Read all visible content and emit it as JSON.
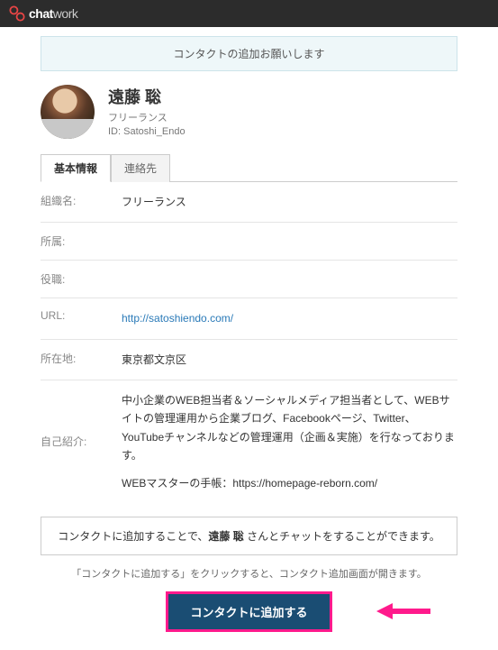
{
  "brand": {
    "part1": "chat",
    "part2": "work"
  },
  "notice": "コンタクトの追加お願いします",
  "profile": {
    "name": "遠藤 聡",
    "role": "フリーランス",
    "id_label": "ID: Satoshi_Endo"
  },
  "tabs": {
    "basic": "基本情報",
    "contact": "連絡先"
  },
  "labels": {
    "org": "組織名:",
    "dept": "所属:",
    "title": "役職:",
    "url": "URL:",
    "location": "所在地:",
    "intro": "自己紹介:"
  },
  "values": {
    "org": "フリーランス",
    "dept": "",
    "title": "",
    "url": "http://satoshiendo.com/",
    "location": "東京都文京区",
    "intro1": "中小企業のWEB担当者＆ソーシャルメディア担当者として、WEBサイトの管理運用から企業ブログ、Facebookページ、Twitter、YouTubeチャンネルなどの管理運用（企画＆実施）を行なっております。",
    "intro2": "WEBマスターの手帳：https://homepage-reborn.com/"
  },
  "add_box_pre": "コンタクトに追加することで、",
  "add_box_name": "遠藤 聡",
  "add_box_post": " さんとチャットをすることができます。",
  "help_text": "「コンタクトに追加する」をクリックすると、コンタクト追加画面が開きます。",
  "cta": "コンタクトに追加する"
}
